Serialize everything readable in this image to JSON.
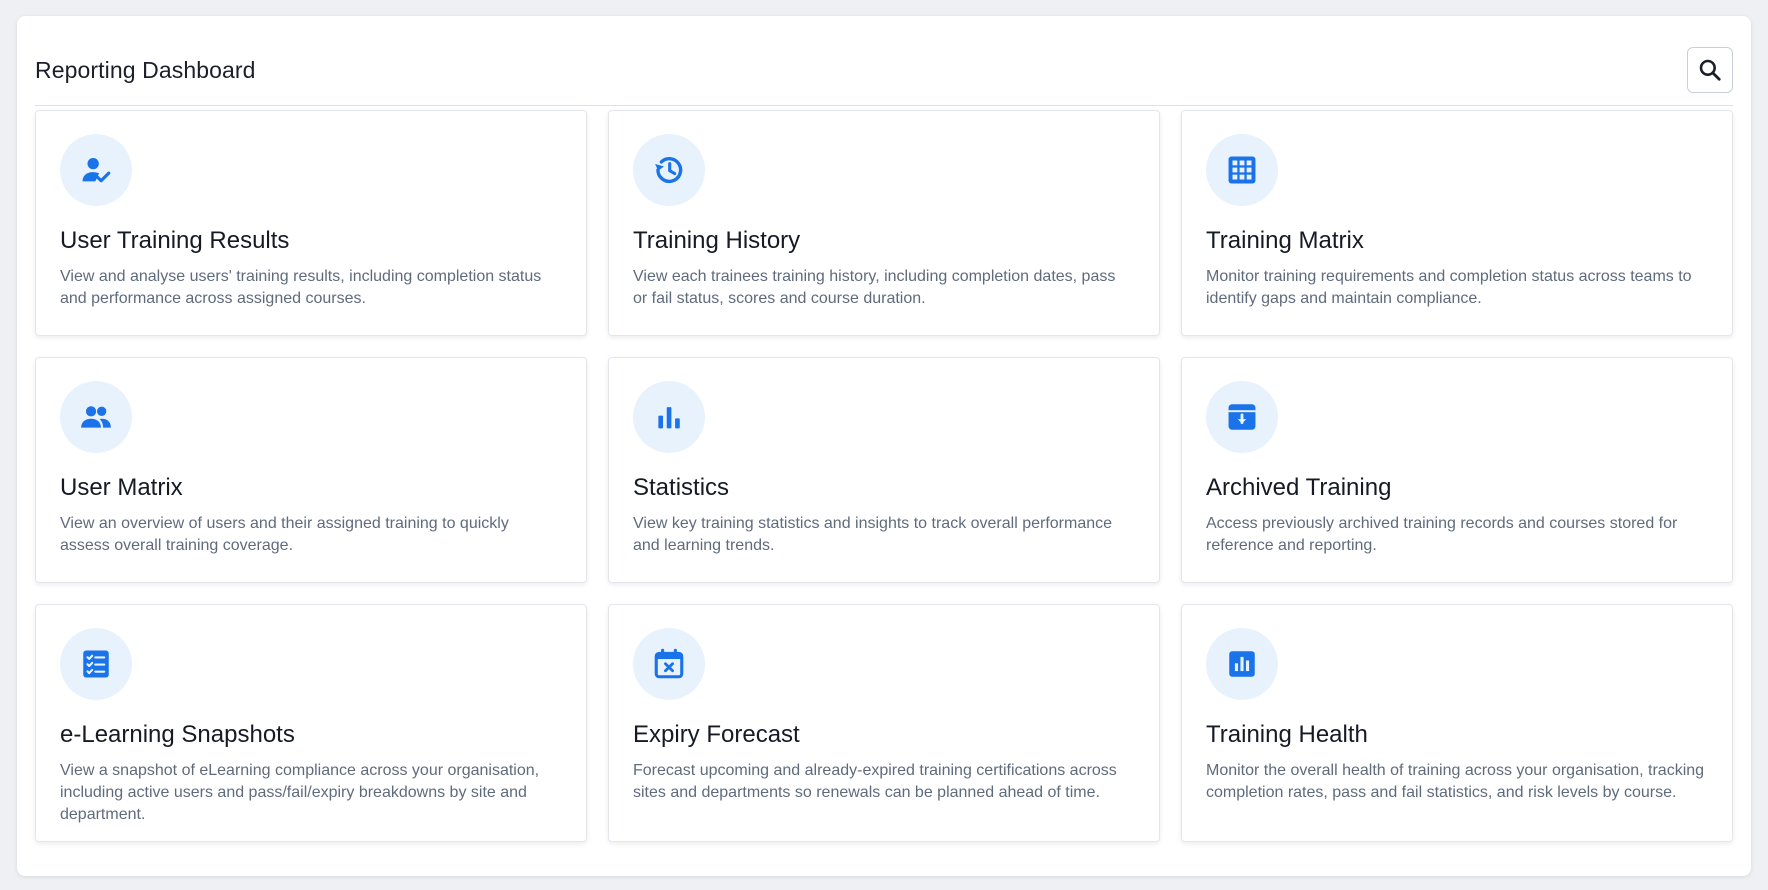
{
  "header": {
    "title": "Reporting Dashboard",
    "search_icon": "search-icon"
  },
  "colors": {
    "accent": "#1a73e8",
    "icon_bg": "#e8f2fd"
  },
  "cards": [
    {
      "title": "User Training Results",
      "description": "View and analyse users' training results, including completion status and performance across assigned courses.",
      "icon": "user-check-icon"
    },
    {
      "title": "Training History",
      "description": "View each trainees training history, including completion dates, pass or fail status, scores and course duration.",
      "icon": "history-icon"
    },
    {
      "title": "Training Matrix",
      "description": "Monitor training requirements and completion status across teams to identify gaps and maintain compliance.",
      "icon": "grid-icon"
    },
    {
      "title": "User Matrix",
      "description": "View an overview of users and their assigned training to quickly assess overall training coverage.",
      "icon": "users-icon"
    },
    {
      "title": "Statistics",
      "description": "View key training statistics and insights to track overall performance and learning trends.",
      "icon": "bar-chart-icon"
    },
    {
      "title": "Archived Training",
      "description": "Access previously archived training records and courses stored for reference and reporting.",
      "icon": "archive-icon"
    },
    {
      "title": "e-Learning Snapshots",
      "description": "View a snapshot of eLearning compliance across your organisation, including active users and pass/fail/expiry breakdowns by site and department.",
      "icon": "checklist-icon"
    },
    {
      "title": "Expiry Forecast",
      "description": "Forecast upcoming and already-expired training certifications across sites and departments so renewals can be planned ahead of time.",
      "icon": "calendar-x-icon"
    },
    {
      "title": "Training Health",
      "description": "Monitor the overall health of training across your organisation, tracking completion rates, pass and fail statistics, and risk levels by course.",
      "icon": "chart-box-icon"
    }
  ]
}
